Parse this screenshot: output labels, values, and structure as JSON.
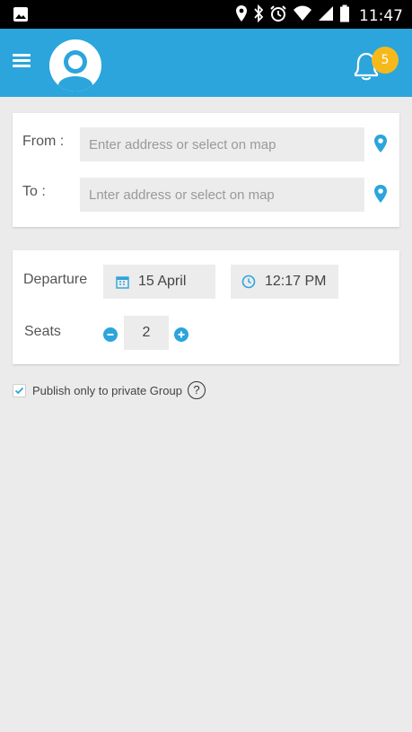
{
  "status_bar": {
    "time": "11:47",
    "icons": [
      "image-icon",
      "location-icon",
      "bluetooth-icon",
      "alarm-icon",
      "wifi-icon",
      "signal-icon",
      "battery-icon"
    ]
  },
  "app_bar": {
    "color": "#2ba5dc",
    "notification_count": "5",
    "badge_color": "#f6b91c"
  },
  "route": {
    "from_label": "From :",
    "from_placeholder": "Enter address or select on map",
    "to_label": "To :",
    "to_placeholder": "Lnter address or select on map"
  },
  "departure": {
    "label": "Departure",
    "date": "15 April",
    "time": "12:17 PM",
    "seats_label": "Seats",
    "seats_value": "2"
  },
  "publish": {
    "label": "Publish only to private Group",
    "checked": true,
    "help": "?"
  }
}
